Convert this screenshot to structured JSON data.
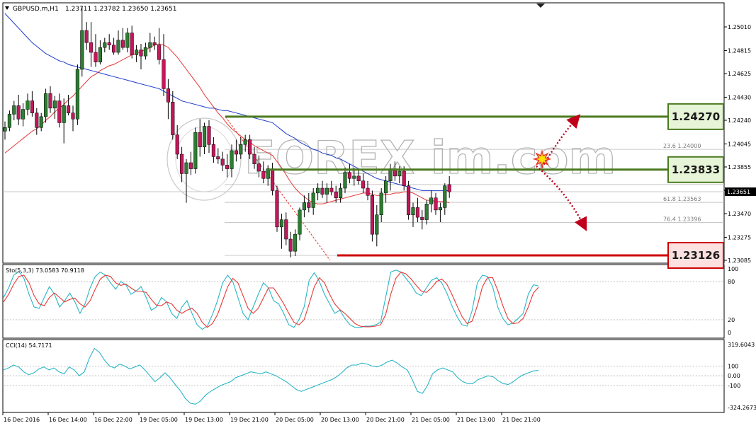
{
  "header": {
    "symbol": "GBPUSD.m,H1",
    "ohlc": "1.23711 1.23782 1.23650 1.23651"
  },
  "watermark": "FOREX im.com",
  "colors": {
    "bull": "#2e7d32",
    "bear": "#c2185b",
    "ma_fast": "#e53935",
    "ma_slow": "#1e3ccc",
    "resistance": "#4a7a1e",
    "support": "#cc0000",
    "stoch_main": "#29b6c6",
    "stoch_signal": "#e53935",
    "cci": "#29b6c6"
  },
  "chart_data": [
    {
      "type": "candlestick",
      "title": "GBPUSD.m,H1",
      "ylim": [
        1.2308,
        1.2512
      ],
      "y_ticks": [
        "1.25010",
        "1.24815",
        "1.24625",
        "1.24430",
        "1.24240",
        "1.24045",
        "1.23855",
        "1.23660",
        "1.23470",
        "1.23275",
        "1.23085"
      ],
      "current_price": "1.23651",
      "x_ticks": [
        "16 Dec 2016",
        "16 Dec 14:00",
        "16 Dec 22:00",
        "19 Dec 05:00",
        "19 Dec 13:00",
        "19 Dec 21:00",
        "20 Dec 05:00",
        "20 Dec 13:00",
        "20 Dec 21:00",
        "21 Dec 05:00",
        "21 Dec 13:00",
        "21 Dec 21:00"
      ],
      "levels": [
        {
          "label": "1.24270",
          "value": 1.2427,
          "kind": "resistance"
        },
        {
          "label": "1.23833",
          "value": 1.23833,
          "kind": "resistance"
        },
        {
          "label": "1.23126",
          "value": 1.23126,
          "kind": "support"
        }
      ],
      "fibonacci": [
        {
          "label": "23.6  1.24000",
          "value": 1.24
        },
        {
          "label": "61.8  1.23563",
          "value": 1.23563
        },
        {
          "label": "76.4  1.23396",
          "value": 1.23396
        }
      ],
      "candles": [
        [
          1.2415,
          1.2423,
          1.2408,
          1.2418
        ],
        [
          1.2418,
          1.2432,
          1.2415,
          1.2429
        ],
        [
          1.2429,
          1.244,
          1.2424,
          1.2436
        ],
        [
          1.2436,
          1.2445,
          1.242,
          1.2425
        ],
        [
          1.2425,
          1.2438,
          1.2419,
          1.2433
        ],
        [
          1.2433,
          1.2446,
          1.2428,
          1.244
        ],
        [
          1.244,
          1.2448,
          1.2427,
          1.243
        ],
        [
          1.243,
          1.2434,
          1.2412,
          1.2418
        ],
        [
          1.2418,
          1.243,
          1.2415,
          1.2427
        ],
        [
          1.2427,
          1.245,
          1.2422,
          1.2446
        ],
        [
          1.2446,
          1.2452,
          1.243,
          1.2434
        ],
        [
          1.2434,
          1.2444,
          1.2425,
          1.244
        ],
        [
          1.244,
          1.2446,
          1.2418,
          1.2422
        ],
        [
          1.2422,
          1.2442,
          1.2405,
          1.2436
        ],
        [
          1.2436,
          1.2445,
          1.2428,
          1.243
        ],
        [
          1.243,
          1.2436,
          1.2415,
          1.2425
        ],
        [
          1.2425,
          1.247,
          1.242,
          1.2466
        ],
        [
          1.2466,
          1.2518,
          1.246,
          1.2498
        ],
        [
          1.2498,
          1.2505,
          1.2482,
          1.2488
        ],
        [
          1.2488,
          1.2505,
          1.2468,
          1.248
        ],
        [
          1.248,
          1.2495,
          1.2468,
          1.2472
        ],
        [
          1.2472,
          1.249,
          1.247,
          1.2484
        ],
        [
          1.2484,
          1.2492,
          1.248,
          1.2488
        ],
        [
          1.2488,
          1.2495,
          1.2482,
          1.2486
        ],
        [
          1.2486,
          1.2492,
          1.2478,
          1.248
        ],
        [
          1.248,
          1.2498,
          1.2478,
          1.249
        ],
        [
          1.249,
          1.25,
          1.2482,
          1.2484
        ],
        [
          1.2484,
          1.25,
          1.248,
          1.2496
        ],
        [
          1.2496,
          1.2502,
          1.2475,
          1.2478
        ],
        [
          1.2478,
          1.2486,
          1.2472,
          1.2482
        ],
        [
          1.2482,
          1.2487,
          1.2466,
          1.2477
        ],
        [
          1.2477,
          1.2488,
          1.2474,
          1.2484
        ],
        [
          1.2484,
          1.2496,
          1.248,
          1.2488
        ],
        [
          1.2488,
          1.2493,
          1.2482,
          1.2486
        ],
        [
          1.2486,
          1.25,
          1.247,
          1.2474
        ],
        [
          1.2474,
          1.2495,
          1.2444,
          1.245
        ],
        [
          1.245,
          1.2458,
          1.2425,
          1.2439
        ],
        [
          1.2439,
          1.2448,
          1.2408,
          1.2412
        ],
        [
          1.2412,
          1.242,
          1.2392,
          1.2396
        ],
        [
          1.2396,
          1.2402,
          1.2373,
          1.238
        ],
        [
          1.238,
          1.2392,
          1.2356,
          1.2389
        ],
        [
          1.2389,
          1.2398,
          1.2379,
          1.2384
        ],
        [
          1.2384,
          1.2418,
          1.238,
          1.2414
        ],
        [
          1.2414,
          1.2425,
          1.2394,
          1.2402
        ],
        [
          1.2402,
          1.2422,
          1.2396,
          1.2419
        ],
        [
          1.2419,
          1.2424,
          1.2397,
          1.2404
        ],
        [
          1.2404,
          1.241,
          1.2389,
          1.2394
        ],
        [
          1.2394,
          1.2401,
          1.2388,
          1.2392
        ],
        [
          1.2392,
          1.2398,
          1.2382,
          1.2387
        ],
        [
          1.2387,
          1.2396,
          1.2377,
          1.2384
        ],
        [
          1.2384,
          1.2404,
          1.2377,
          1.2399
        ],
        [
          1.2399,
          1.2408,
          1.239,
          1.2396
        ],
        [
          1.2396,
          1.241,
          1.2392,
          1.2404
        ],
        [
          1.2404,
          1.2412,
          1.2398,
          1.2408
        ],
        [
          1.2408,
          1.2412,
          1.2392,
          1.2396
        ],
        [
          1.2396,
          1.2402,
          1.2384,
          1.2388
        ],
        [
          1.2388,
          1.2395,
          1.2377,
          1.2382
        ],
        [
          1.2382,
          1.239,
          1.2372,
          1.2376
        ],
        [
          1.2376,
          1.2387,
          1.237,
          1.2384
        ],
        [
          1.2384,
          1.2389,
          1.2362,
          1.2366
        ],
        [
          1.2366,
          1.237,
          1.2332,
          1.2336
        ],
        [
          1.2336,
          1.2347,
          1.2318,
          1.2342
        ],
        [
          1.2342,
          1.2348,
          1.2321,
          1.2326
        ],
        [
          1.2326,
          1.2332,
          1.2311,
          1.2316
        ],
        [
          1.2316,
          1.2334,
          1.2312,
          1.233
        ],
        [
          1.233,
          1.2352,
          1.2325,
          1.235
        ],
        [
          1.235,
          1.2362,
          1.2344,
          1.2356
        ],
        [
          1.2356,
          1.2364,
          1.2348,
          1.2352
        ],
        [
          1.2352,
          1.2368,
          1.2346,
          1.2364
        ],
        [
          1.2364,
          1.2372,
          1.2358,
          1.2368
        ],
        [
          1.2368,
          1.2374,
          1.236,
          1.2363
        ],
        [
          1.2363,
          1.2372,
          1.2356,
          1.2368
        ],
        [
          1.2368,
          1.2374,
          1.2362,
          1.2365
        ],
        [
          1.2365,
          1.237,
          1.2356,
          1.236
        ],
        [
          1.236,
          1.2372,
          1.2356,
          1.2368
        ],
        [
          1.2368,
          1.2385,
          1.2364,
          1.2381
        ],
        [
          1.2381,
          1.2388,
          1.2372,
          1.2376
        ],
        [
          1.2376,
          1.2385,
          1.237,
          1.2378
        ],
        [
          1.2378,
          1.2384,
          1.2371,
          1.2374
        ],
        [
          1.2374,
          1.238,
          1.2364,
          1.2368
        ],
        [
          1.2368,
          1.2374,
          1.2358,
          1.2362
        ],
        [
          1.2362,
          1.2366,
          1.2324,
          1.233
        ],
        [
          1.233,
          1.2354,
          1.232,
          1.2346
        ],
        [
          1.2346,
          1.2368,
          1.234,
          1.2364
        ],
        [
          1.2364,
          1.2378,
          1.2356,
          1.2374
        ],
        [
          1.2374,
          1.2388,
          1.2366,
          1.2384
        ],
        [
          1.2384,
          1.239,
          1.2374,
          1.2378
        ],
        [
          1.2378,
          1.2386,
          1.2372,
          1.2382
        ],
        [
          1.2382,
          1.2386,
          1.2366,
          1.237
        ],
        [
          1.237,
          1.2374,
          1.2342,
          1.2346
        ],
        [
          1.2346,
          1.2356,
          1.2336,
          1.2352
        ],
        [
          1.2352,
          1.236,
          1.234,
          1.2344
        ],
        [
          1.2344,
          1.235,
          1.2334,
          1.2342
        ],
        [
          1.2342,
          1.2358,
          1.2338,
          1.2355
        ],
        [
          1.2355,
          1.2366,
          1.2348,
          1.236
        ],
        [
          1.236,
          1.2364,
          1.2346,
          1.235
        ],
        [
          1.235,
          1.2356,
          1.234,
          1.2352
        ],
        [
          1.2352,
          1.2372,
          1.2346,
          1.237
        ],
        [
          1.2371,
          1.2378,
          1.236,
          1.2365
        ]
      ],
      "ma_fast": [
        1.2397,
        1.24,
        1.2403,
        1.2406,
        1.2409,
        1.2412,
        1.2415,
        1.2417,
        1.242,
        1.2424,
        1.2427,
        1.2431,
        1.2434,
        1.2437,
        1.2441,
        1.2444,
        1.2448,
        1.2452,
        1.2456,
        1.246,
        1.2462,
        1.2465,
        1.2467,
        1.2469,
        1.247,
        1.2472,
        1.2474,
        1.2476,
        1.2478,
        1.2479,
        1.2481,
        1.2482,
        1.2484,
        1.2486,
        1.2487,
        1.2486,
        1.2484,
        1.248,
        1.2476,
        1.2471,
        1.2466,
        1.2461,
        1.2456,
        1.2451,
        1.2445,
        1.244,
        1.2435,
        1.243,
        1.2426,
        1.2421,
        1.2417,
        1.2414,
        1.2411,
        1.2408,
        1.2406,
        1.2403,
        1.2401,
        1.2399,
        1.2397,
        1.2395,
        1.239,
        1.2385,
        1.2379,
        1.2373,
        1.2368,
        1.2364,
        1.2361,
        1.2358,
        1.2356,
        1.2355,
        1.2355,
        1.2356,
        1.2357,
        1.2358,
        1.2359,
        1.236,
        1.2361,
        1.2362,
        1.2363,
        1.2364,
        1.2364,
        1.2363,
        1.2362,
        1.2362,
        1.2363,
        1.2363,
        1.2364,
        1.2364,
        1.2365,
        1.2365,
        1.2364,
        1.2362,
        1.236,
        1.2358,
        1.2358,
        1.2357,
        1.2357,
        1.2357,
        1.2356
      ],
      "ma_slow": [
        1.2512,
        1.2508,
        1.2504,
        1.25,
        1.2496,
        1.2492,
        1.2488,
        1.2485,
        1.2482,
        1.2479,
        1.2477,
        1.2475,
        1.2473,
        1.2472,
        1.247,
        1.2469,
        1.2468,
        1.2467,
        1.2466,
        1.2465,
        1.2464,
        1.2463,
        1.2462,
        1.2461,
        1.246,
        1.2459,
        1.2458,
        1.2457,
        1.2456,
        1.2455,
        1.2454,
        1.2453,
        1.2452,
        1.2451,
        1.245,
        1.2448,
        1.2446,
        1.2444,
        1.2442,
        1.244,
        1.2439,
        1.2438,
        1.2437,
        1.2436,
        1.2435,
        1.2434,
        1.2434,
        1.2433,
        1.2432,
        1.2432,
        1.2431,
        1.243,
        1.2429,
        1.2428,
        1.2427,
        1.2426,
        1.2425,
        1.2424,
        1.2423,
        1.2422,
        1.2419,
        1.2416,
        1.2413,
        1.2411,
        1.2409,
        1.2406,
        1.2404,
        1.2402,
        1.24,
        1.2399,
        1.2397,
        1.2396,
        1.2395,
        1.2393,
        1.2392,
        1.239,
        1.2388,
        1.2386,
        1.2384,
        1.2382,
        1.238,
        1.2378,
        1.2376,
        1.2375,
        1.2374,
        1.2373,
        1.2372,
        1.2371,
        1.237,
        1.2369,
        1.2368,
        1.2367,
        1.2366,
        1.2366,
        1.2366,
        1.2366,
        1.2366,
        1.2366,
        1.2366
      ],
      "arrow_up_target": 1.2427,
      "arrow_down_target": 1.2335
    },
    {
      "type": "line",
      "title": "Sto(5,3,3) 73.0583 70.9118",
      "ylim": [
        0,
        100
      ],
      "y_ticks": [
        "100",
        "80",
        "20",
        "0"
      ],
      "series": [
        {
          "name": "main",
          "values": [
            55,
            70,
            90,
            96,
            85,
            60,
            40,
            38,
            55,
            72,
            60,
            40,
            50,
            62,
            48,
            30,
            45,
            70,
            88,
            95,
            90,
            78,
            68,
            80,
            75,
            60,
            65,
            72,
            55,
            35,
            40,
            55,
            48,
            30,
            22,
            40,
            50,
            30,
            12,
            5,
            10,
            28,
            50,
            78,
            90,
            80,
            55,
            30,
            20,
            40,
            60,
            78,
            70,
            50,
            45,
            30,
            12,
            8,
            20,
            40,
            82,
            94,
            80,
            60,
            45,
            30,
            35,
            22,
            12,
            8,
            8,
            10,
            10,
            12,
            16,
            55,
            95,
            98,
            95,
            85,
            75,
            62,
            58,
            70,
            82,
            86,
            78,
            62,
            42,
            25,
            12,
            10,
            35,
            78,
            90,
            88,
            72,
            40,
            22,
            12,
            15,
            22,
            30,
            60,
            75,
            73
          ]
        },
        {
          "name": "signal",
          "values": [
            48,
            60,
            76,
            88,
            90,
            78,
            58,
            45,
            42,
            55,
            62,
            55,
            48,
            52,
            54,
            45,
            40,
            50,
            68,
            84,
            90,
            88,
            78,
            74,
            76,
            70,
            65,
            65,
            63,
            52,
            43,
            42,
            48,
            45,
            35,
            30,
            35,
            38,
            30,
            16,
            8,
            14,
            28,
            50,
            72,
            85,
            78,
            58,
            38,
            30,
            38,
            54,
            70,
            70,
            58,
            45,
            30,
            16,
            12,
            20,
            45,
            72,
            86,
            78,
            60,
            45,
            36,
            30,
            22,
            14,
            10,
            9,
            9,
            10,
            12,
            28,
            60,
            85,
            95,
            92,
            84,
            74,
            65,
            63,
            70,
            80,
            84,
            76,
            60,
            42,
            25,
            14,
            18,
            42,
            72,
            86,
            86,
            66,
            42,
            22,
            14,
            15,
            22,
            40,
            62,
            71
          ]
        }
      ]
    },
    {
      "type": "line",
      "title": "CCI(14) 54.7171",
      "ylim": [
        -324.2673,
        319.6043
      ],
      "y_ticks": [
        "319.6043",
        "100",
        "0.00",
        "-100",
        "-324.2673"
      ],
      "series": [
        {
          "name": "CCI",
          "values": [
            60,
            80,
            110,
            90,
            40,
            10,
            30,
            70,
            90,
            60,
            80,
            40,
            20,
            90,
            60,
            0,
            40,
            180,
            280,
            240,
            160,
            100,
            80,
            120,
            100,
            70,
            90,
            110,
            60,
            0,
            -60,
            -20,
            30,
            -20,
            -90,
            -150,
            -230,
            -280,
            -290,
            -260,
            -200,
            -160,
            -130,
            -100,
            -80,
            -60,
            -20,
            0,
            20,
            40,
            30,
            20,
            40,
            20,
            0,
            -30,
            -60,
            -100,
            -140,
            -160,
            -140,
            -120,
            -100,
            -80,
            -60,
            -40,
            -10,
            30,
            80,
            110,
            110,
            130,
            120,
            100,
            90,
            110,
            140,
            160,
            130,
            90,
            60,
            -40,
            -160,
            -180,
            -100,
            20,
            60,
            80,
            60,
            40,
            -20,
            -60,
            -80,
            -80,
            -40,
            -20,
            0,
            -10,
            -50,
            -80,
            -90,
            -60,
            -20,
            10,
            30,
            50,
            54.7171
          ]
        }
      ]
    }
  ]
}
